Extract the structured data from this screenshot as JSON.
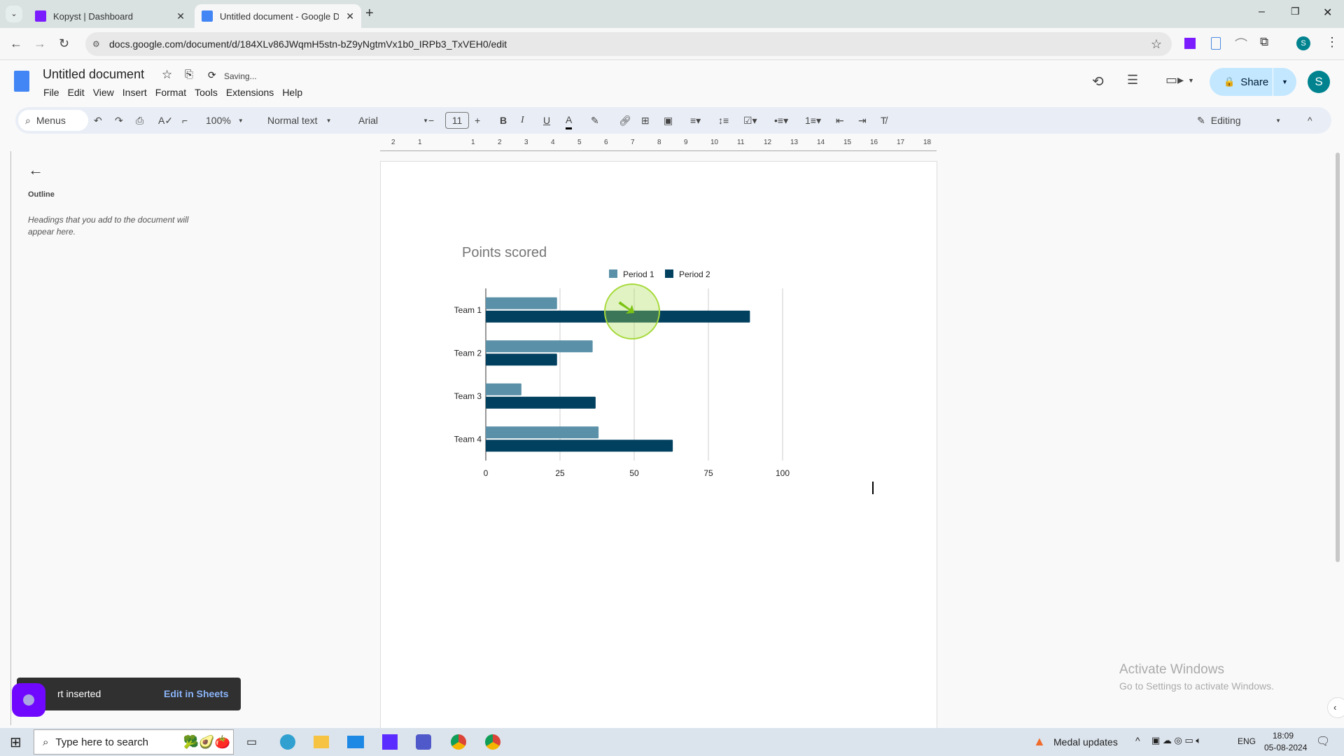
{
  "browser": {
    "tabs": [
      {
        "label": "Kopyst | Dashboard",
        "active": false
      },
      {
        "label": "Untitled document - Google Do",
        "active": true
      }
    ],
    "url": "docs.google.com/document/d/184XLv86JWqmH5stn-bZ9yNgtmVx1b0_IRPb3_TxVEH0/edit",
    "profile_initial": "S"
  },
  "doc": {
    "title": "Untitled document",
    "status": "Saving...",
    "menu": [
      "File",
      "Edit",
      "View",
      "Insert",
      "Format",
      "Tools",
      "Extensions",
      "Help"
    ],
    "share_label": "Share",
    "avatar_initial": "S",
    "toolbar": {
      "menus_label": "Menus",
      "zoom": "100%",
      "style": "Normal text",
      "font": "Arial",
      "font_size": "11",
      "mode": "Editing"
    },
    "ruler_ticks": [
      "2",
      "1",
      "",
      "1",
      "2",
      "3",
      "4",
      "5",
      "6",
      "7",
      "8",
      "9",
      "10",
      "11",
      "12",
      "13",
      "14",
      "15",
      "16",
      "17",
      "18"
    ]
  },
  "outline": {
    "title": "Outline",
    "hint": "Headings that you add to the document will appear here."
  },
  "toast": {
    "message": "Chart inserted",
    "visible_message": "rt inserted",
    "action": "Edit in Sheets"
  },
  "watermark": {
    "title": "Activate Windows",
    "subtitle": "Go to Settings to activate Windows."
  },
  "taskbar": {
    "search_placeholder": "Type here to search",
    "notification": "Medal updates",
    "lang": "ENG",
    "time": "18:09",
    "date": "05-08-2024"
  },
  "colors": {
    "period1": "#5b91a8",
    "period2": "#01405f",
    "accent": "#1a73e8",
    "share_bg": "#c2e7ff",
    "avatar": "#00838f"
  },
  "chart_data": {
    "type": "bar",
    "orientation": "horizontal",
    "title": "Points scored",
    "categories": [
      "Team 1",
      "Team 2",
      "Team 3",
      "Team 4"
    ],
    "series": [
      {
        "name": "Period 1",
        "values": [
          24,
          36,
          12,
          38
        ]
      },
      {
        "name": "Period 2",
        "values": [
          89,
          24,
          37,
          63
        ]
      }
    ],
    "xlim": [
      0,
      100
    ],
    "xticks": [
      "0",
      "25",
      "50",
      "75",
      "100"
    ],
    "xlabel": "",
    "ylabel": "",
    "grid": true,
    "legend": "top-center"
  }
}
